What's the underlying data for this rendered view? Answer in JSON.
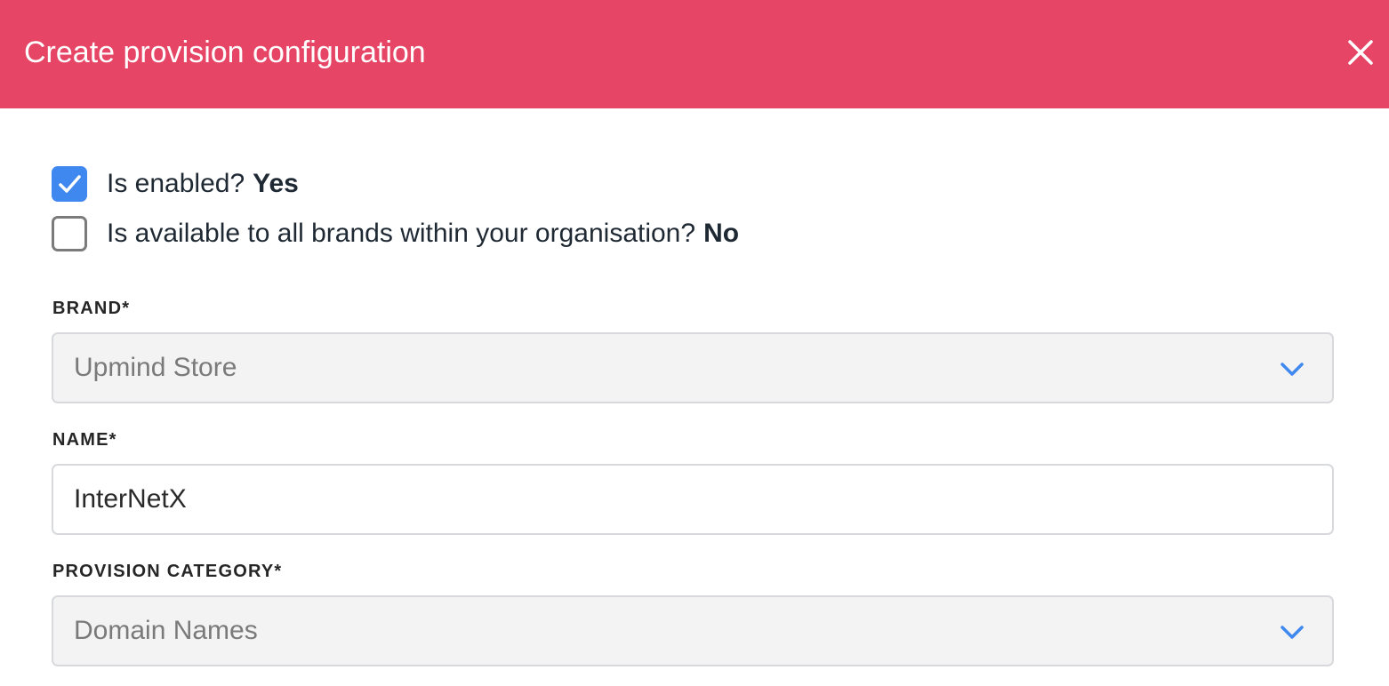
{
  "header": {
    "title": "Create provision configuration",
    "background_color": "#e64566",
    "close_icon": "close-icon"
  },
  "checkboxes": {
    "enabled": {
      "label": "Is enabled?",
      "value": "Yes",
      "checked": true
    },
    "all_brands": {
      "label": "Is available to all brands within your organisation?",
      "value": "No",
      "checked": false
    }
  },
  "fields": {
    "brand": {
      "label": "BRAND*",
      "value": "Upmind Store",
      "type": "select"
    },
    "name": {
      "label": "NAME*",
      "value": "InterNetX",
      "type": "text"
    },
    "provision_category": {
      "label": "PROVISION CATEGORY*",
      "value": "Domain Names",
      "type": "select"
    }
  },
  "colors": {
    "accent": "#3f88f0",
    "chevron": "#3f88f0"
  }
}
